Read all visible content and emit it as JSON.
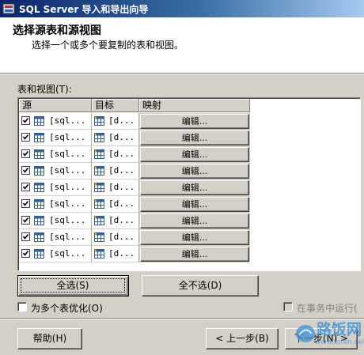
{
  "window": {
    "title": "SQL Server 导入和导出向导"
  },
  "header": {
    "title": "选择源表和源视图",
    "subtitle": "选择一个或多个要复制的表和视图。"
  },
  "tables_label": "表和视图(T):",
  "columns": {
    "source": "源",
    "target": "目标",
    "mapping": "映射"
  },
  "rows": [
    {
      "checked": true,
      "source": "[sql...",
      "target": "[d...",
      "edit": "编辑..."
    },
    {
      "checked": true,
      "source": "[sql...",
      "target": "[d...",
      "edit": "编辑..."
    },
    {
      "checked": true,
      "source": "[sql...",
      "target": "[d...",
      "edit": "编辑..."
    },
    {
      "checked": true,
      "source": "[sql...",
      "target": "[d...",
      "edit": "编辑..."
    },
    {
      "checked": true,
      "source": "[sql...",
      "target": "[d...",
      "edit": "编辑..."
    },
    {
      "checked": true,
      "source": "[sql...",
      "target": "[d...",
      "edit": "编辑..."
    },
    {
      "checked": true,
      "source": "[sql...",
      "target": "[d...",
      "edit": "编辑..."
    },
    {
      "checked": true,
      "source": "[sql...",
      "target": "[d...",
      "edit": "编辑..."
    },
    {
      "checked": true,
      "source": "[sql...",
      "target": "[d...",
      "edit": "编辑..."
    }
  ],
  "buttons": {
    "select_all": "全选(S)",
    "deselect_all": "全不选(D)",
    "help": "帮助(H)",
    "back": "< 上一步(B)",
    "next": "下一步(N) >"
  },
  "options": {
    "optimize_multi": {
      "label": "为多个表优化(O)",
      "checked": false
    },
    "run_in_transaction": {
      "label": "在事务中运行(",
      "checked": false,
      "enabled": false
    }
  },
  "watermark": {
    "text": "路饭网",
    "url": "www.lufan.net",
    "icon": "logo-icon"
  },
  "colors": {
    "titlebar_start": "#0a246a",
    "titlebar_end": "#a6caf0",
    "face": "#d4d0c8"
  }
}
